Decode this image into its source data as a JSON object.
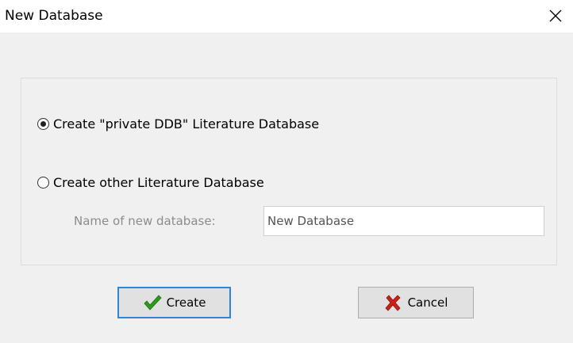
{
  "window": {
    "title": "New Database"
  },
  "options": [
    {
      "label": "Create \"private DDB\" Literature Database",
      "selected": true
    },
    {
      "label": "Create other Literature Database",
      "selected": false
    }
  ],
  "name_field": {
    "label": "Name of new database:",
    "value": "New Database"
  },
  "buttons": {
    "create_label": "Create",
    "cancel_label": "Cancel"
  },
  "icons": {
    "create": "green-checkmark-icon",
    "cancel": "red-x-icon",
    "close": "close-icon"
  },
  "colors": {
    "default_button_border": "#2f86d6",
    "check_green": "#2e9b1d",
    "cancel_red": "#c8221a"
  }
}
